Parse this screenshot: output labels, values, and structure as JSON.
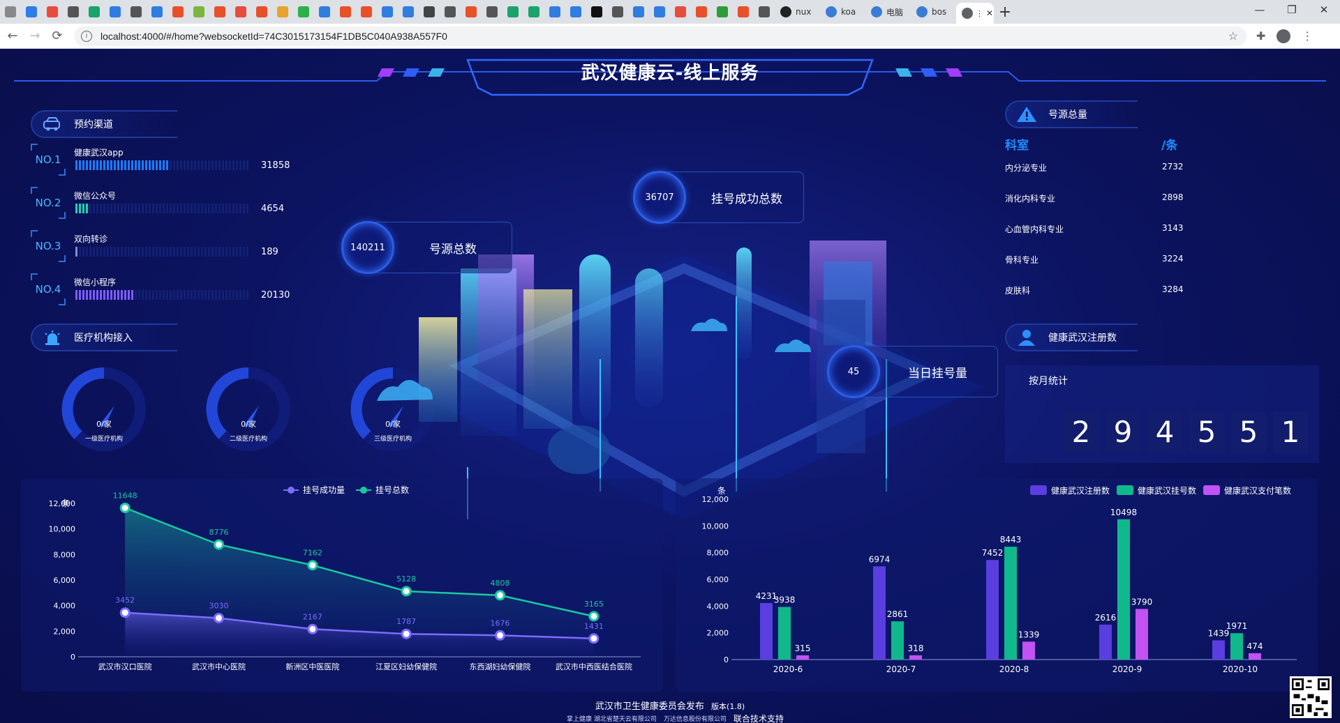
{
  "browser": {
    "active_tab_label": "",
    "tabs_small": [
      "nux",
      "koa",
      "电脑",
      "bos"
    ],
    "new_tab": "+",
    "url": "localhost:4000/#/home?websocketId=74C3015173154F1DB5C040A938A557F0",
    "win_controls": [
      "—",
      "❐",
      "✕"
    ],
    "nav": [
      "←",
      "→",
      "⟳"
    ]
  },
  "dashboard": {
    "title": "武汉健康云-线上服务",
    "booking_channels": {
      "heading": "预约渠道",
      "items": [
        {
          "rank": "NO.1",
          "label": "健康武汉app",
          "value": "31858",
          "fraction": 0.54,
          "color": "#1f7bff"
        },
        {
          "rank": "NO.2",
          "label": "微信公众号",
          "value": "4654",
          "fraction": 0.08,
          "color": "#19d2b4"
        },
        {
          "rank": "NO.3",
          "label": "双向转诊",
          "value": "189",
          "fraction": 0.01,
          "color": "#7a8fd8"
        },
        {
          "rank": "NO.4",
          "label": "微信小程序",
          "value": "20130",
          "fraction": 0.34,
          "color": "#7b5cff"
        }
      ]
    },
    "institutions": {
      "heading": "医疗机构接入",
      "gauges": [
        {
          "value": "0/家",
          "label": "一级医疗机构"
        },
        {
          "value": "0/家",
          "label": "二级医疗机构"
        },
        {
          "value": "0/家",
          "label": "三级医疗机构"
        }
      ]
    },
    "center": {
      "total_sources": {
        "value": "140211",
        "label": "号源总数"
      },
      "total_success": {
        "value": "36707",
        "label": "挂号成功总数"
      },
      "today": {
        "value": "45",
        "label": "当日挂号量"
      }
    },
    "source_total": {
      "heading": "号源总量",
      "col_dept": "科室",
      "col_unit": "/条",
      "rows": [
        {
          "dept": "内分泌专业",
          "value": "2732"
        },
        {
          "dept": "消化内科专业",
          "value": "2898"
        },
        {
          "dept": "心血管内科专业",
          "value": "3143"
        },
        {
          "dept": "骨科专业",
          "value": "3224"
        },
        {
          "dept": "皮肤科",
          "value": "3284"
        }
      ]
    },
    "registrations": {
      "heading": "健康武汉注册数",
      "sub": "按月统计",
      "digits": [
        "2",
        "9",
        "4",
        "5",
        "5",
        "1"
      ]
    },
    "footer": {
      "publisher": "武汉市卫生健康委员会发布",
      "version": "版本(1.8)",
      "support": "联合技术支持",
      "logo1": "掌上健康 湖北省楚天云有限公司",
      "logo2": "万达信息股份有限公司"
    }
  },
  "chart_data": [
    {
      "type": "line",
      "ylabel": "条",
      "ylim": [
        0,
        12000
      ],
      "yticks": [
        "0",
        "2,000",
        "4,000",
        "6,000",
        "8,000",
        "10,000",
        "12,000"
      ],
      "categories": [
        "武汉市汉口医院",
        "武汉市中心医院",
        "新洲区中医医院",
        "江夏区妇幼保健院",
        "东西湖妇幼保健院",
        "武汉市中西医结合医院"
      ],
      "series": [
        {
          "name": "挂号成功量",
          "values": [
            3452,
            3030,
            2167,
            1787,
            1676,
            1431
          ],
          "color": "#7b6cff"
        },
        {
          "name": "挂号总数",
          "values": [
            11648,
            8776,
            7162,
            5128,
            4808,
            3165
          ],
          "color": "#19c9a1"
        }
      ],
      "legend": "top-center"
    },
    {
      "type": "bar",
      "ylabel": "条",
      "ylim": [
        0,
        12000
      ],
      "yticks": [
        "0",
        "2,000",
        "4,000",
        "6,000",
        "8,000",
        "10,000",
        "12,000"
      ],
      "categories": [
        "2020-6",
        "2020-7",
        "2020-8",
        "2020-9",
        "2020-10"
      ],
      "series": [
        {
          "name": "健康武汉注册数",
          "values": [
            4231,
            6974,
            7452,
            2616,
            1439
          ],
          "color": "#5a3ee0"
        },
        {
          "name": "健康武汉挂号数",
          "values": [
            3938,
            2861,
            8443,
            10498,
            1971
          ],
          "color": "#10b98c"
        },
        {
          "name": "健康武汉支付笔数",
          "values": [
            315,
            318,
            1339,
            3790,
            474
          ],
          "color": "#c252f2"
        }
      ],
      "legend": "top-right"
    }
  ]
}
